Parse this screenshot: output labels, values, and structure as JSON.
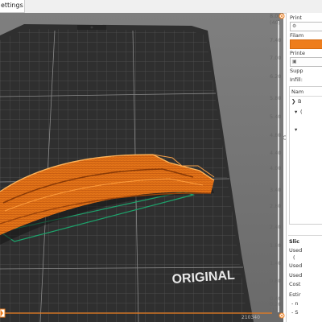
{
  "tabs": [
    {
      "label": "ettings",
      "active": true
    }
  ],
  "viewport": {
    "bed_label": "ORIGINAL ",
    "coords_readout": "210340",
    "colors": {
      "bed": "#2e2e2e",
      "grid": "#5a5a5a",
      "model": "#e87b1e",
      "model_shadow": "#a64a10",
      "outline": "#18a06a",
      "background": "#767676"
    }
  },
  "layer_slider": {
    "top_value": "8.00",
    "top_layer": "(40)",
    "bottom_value": "0.20",
    "bottom_layer": "(1)",
    "ticks": [
      "7.40",
      "7.00",
      "6.20",
      "5.80",
      "5.40",
      "4.80",
      "4.40",
      "4.00",
      "3.40",
      "2.80",
      "2.40",
      "1.80",
      "1.40",
      "0.80",
      "0.40"
    ],
    "accent_color": "#ee7d1c"
  },
  "settings_panel": {
    "print_label": "Print",
    "filament_label": "Filam",
    "printer_label": "Printe",
    "supports_label": "Supp",
    "infill_label": "Infill:",
    "tree_header": "Nam",
    "tree_items": [
      {
        "expander": "❯",
        "label": "B"
      },
      {
        "expander": "▾",
        "label": "("
      },
      {
        "expander": "▾",
        "label": ""
      }
    ],
    "slice_title": "Slic",
    "stats": [
      "Used",
      "(",
      "Used",
      "Used",
      "Cost",
      "Estir",
      "- n",
      "- S"
    ],
    "accent_color": "#ee7d1c"
  }
}
